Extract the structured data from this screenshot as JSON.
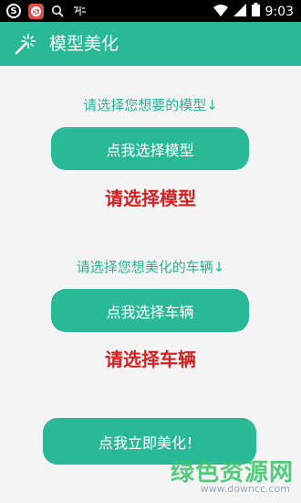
{
  "status_bar": {
    "time": "9:03",
    "icons": [
      "sogou-icon",
      "sogou-red-icon",
      "search-icon",
      "notification-icon",
      "wifi-icon",
      "signal-icon",
      "battery-icon"
    ]
  },
  "app_bar": {
    "title": "模型美化",
    "icon": "magic-wand-icon",
    "color": "#29b997"
  },
  "sections": {
    "model": {
      "prompt": "请选择您想要的模型↓",
      "button_label": "点我选择模型",
      "status": "请选择模型"
    },
    "vehicle": {
      "prompt": "请选择您想美化的车辆↓",
      "button_label": "点我选择车辆",
      "status": "请选择车辆"
    }
  },
  "action": {
    "button_label": "点我立即美化！"
  },
  "watermark": {
    "text": "绿色资源网",
    "url": "www.downcc.com"
  },
  "colors": {
    "accent": "#29b997",
    "prompt_text": "#2ab395",
    "status_text": "#d42222",
    "background": "#f4f4f4"
  }
}
